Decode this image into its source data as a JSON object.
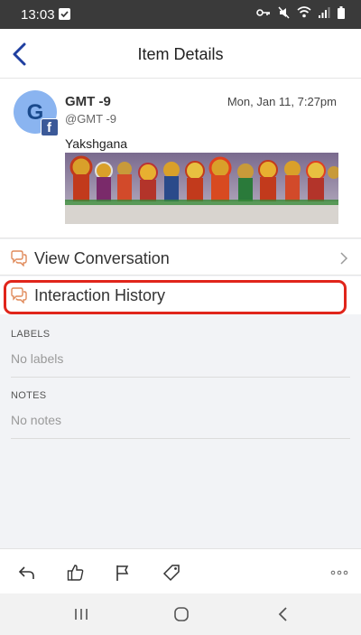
{
  "status_bar": {
    "time": "13:03",
    "icons": [
      "checkbox-icon",
      "key-icon",
      "mute-icon",
      "wifi-icon",
      "signal-icon",
      "battery-icon"
    ]
  },
  "header": {
    "title": "Item Details",
    "back_icon": "chevron-left-icon"
  },
  "post": {
    "avatar_letter": "G",
    "network_icon": "facebook-icon",
    "author": "GMT -9",
    "handle": "@GMT -9",
    "date": "Mon, Jan 11, 7:27pm",
    "text": "Yakshgana"
  },
  "actions": {
    "view_conversation": "View Conversation",
    "interaction_history": "Interaction History"
  },
  "labels": {
    "title": "LABELS",
    "empty": "No labels"
  },
  "notes": {
    "title": "NOTES",
    "empty": "No notes"
  },
  "toolbar": {
    "icons": [
      "reply-icon",
      "like-icon",
      "flag-icon",
      "tag-icon",
      "more-icon"
    ]
  },
  "system_nav": {
    "icons": [
      "recents-icon",
      "home-icon",
      "back-icon"
    ]
  },
  "colors": {
    "accent": "#1f3fa0",
    "highlight": "#e0251b",
    "action_icon": "#e08a5a",
    "facebook": "#3b5998"
  }
}
